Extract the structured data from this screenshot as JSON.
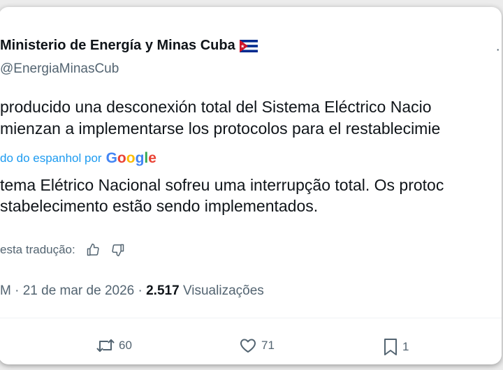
{
  "author": {
    "name": "Ministerio de Energía y Minas Cuba",
    "handle": "@EnergiaMinasCub",
    "flag_icon": "cuba-flag-icon"
  },
  "tweet": {
    "original_lines": [
      "producido una desconexión total del Sistema Eléctrico Nacio",
      "mienzan a implementarse los protocolos para el restablecimie"
    ],
    "translated_by_prefix": "do do espanhol por",
    "translated_by_brand": [
      "G",
      "o",
      "o",
      "g",
      "l",
      "e"
    ],
    "translation_lines": [
      "tema Elétrico Nacional sofreu uma interrupção total. Os protoc",
      "stabelecimento estão sendo implementados."
    ],
    "rate_label": "esta tradução:",
    "timestamp": "M · 21 de mar de 2026 ·",
    "views_count": "2.517",
    "views_label": "Visualizações"
  },
  "actions": {
    "retweets": "60",
    "likes": "71",
    "bookmarks": "1"
  },
  "colors": {
    "link": "#1d9bf0",
    "secondary": "#536471",
    "primary": "#0f1419"
  }
}
